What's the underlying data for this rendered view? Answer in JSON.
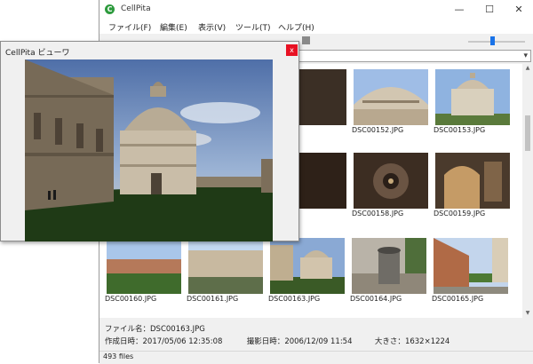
{
  "main_window": {
    "title": "CellPita",
    "logo_letter": "C",
    "window_buttons": [
      "—",
      "☐",
      "✕"
    ]
  },
  "menu": [
    "ファイル(F)",
    "編集(E)",
    "表示(V)",
    "ツール(T)",
    "ヘルプ(H)"
  ],
  "thumbnails": [
    {
      "name": "DSC00151.JPG",
      "caption": "51.JPG"
    },
    {
      "name": "DSC00152.JPG",
      "caption": "DSC00152.JPG"
    },
    {
      "name": "DSC00153.JPG",
      "caption": "DSC00153.JPG"
    },
    {
      "name": "DSC00156.JPG",
      "caption": "56.JPG"
    },
    {
      "name": "DSC00158.JPG",
      "caption": "DSC00158.JPG"
    },
    {
      "name": "DSC00159.JPG",
      "caption": "DSC00159.JPG"
    },
    {
      "name": "DSC00160.JPG",
      "caption": "DSC00160.JPG"
    },
    {
      "name": "DSC00161.JPG",
      "caption": "DSC00161.JPG"
    },
    {
      "name": "DSC00163.JPG",
      "caption": "DSC00163.JPG"
    },
    {
      "name": "DSC00164.JPG",
      "caption": "DSC00164.JPG"
    },
    {
      "name": "DSC00165.JPG",
      "caption": "DSC00165.JPG"
    }
  ],
  "info": {
    "file_name_label": "ファイル名：",
    "file_name": "DSC00163.JPG",
    "created_label": "作成日時：",
    "created": "2017/05/06 12:35:08",
    "taken_label": "撮影日時：",
    "taken": "2006/12/09 11:54",
    "size_label": "大きさ：",
    "size": "1632×1224"
  },
  "status": {
    "text": "493 files"
  },
  "viewer": {
    "title": "CellPita ビューワ",
    "close": "x"
  },
  "icons": {
    "search": "search-icon",
    "dropdown": "chevron-down-icon"
  },
  "colors": {
    "logo_green": "#2e9b3e",
    "close_red": "#e81123",
    "slider_blue": "#1a73e8"
  }
}
